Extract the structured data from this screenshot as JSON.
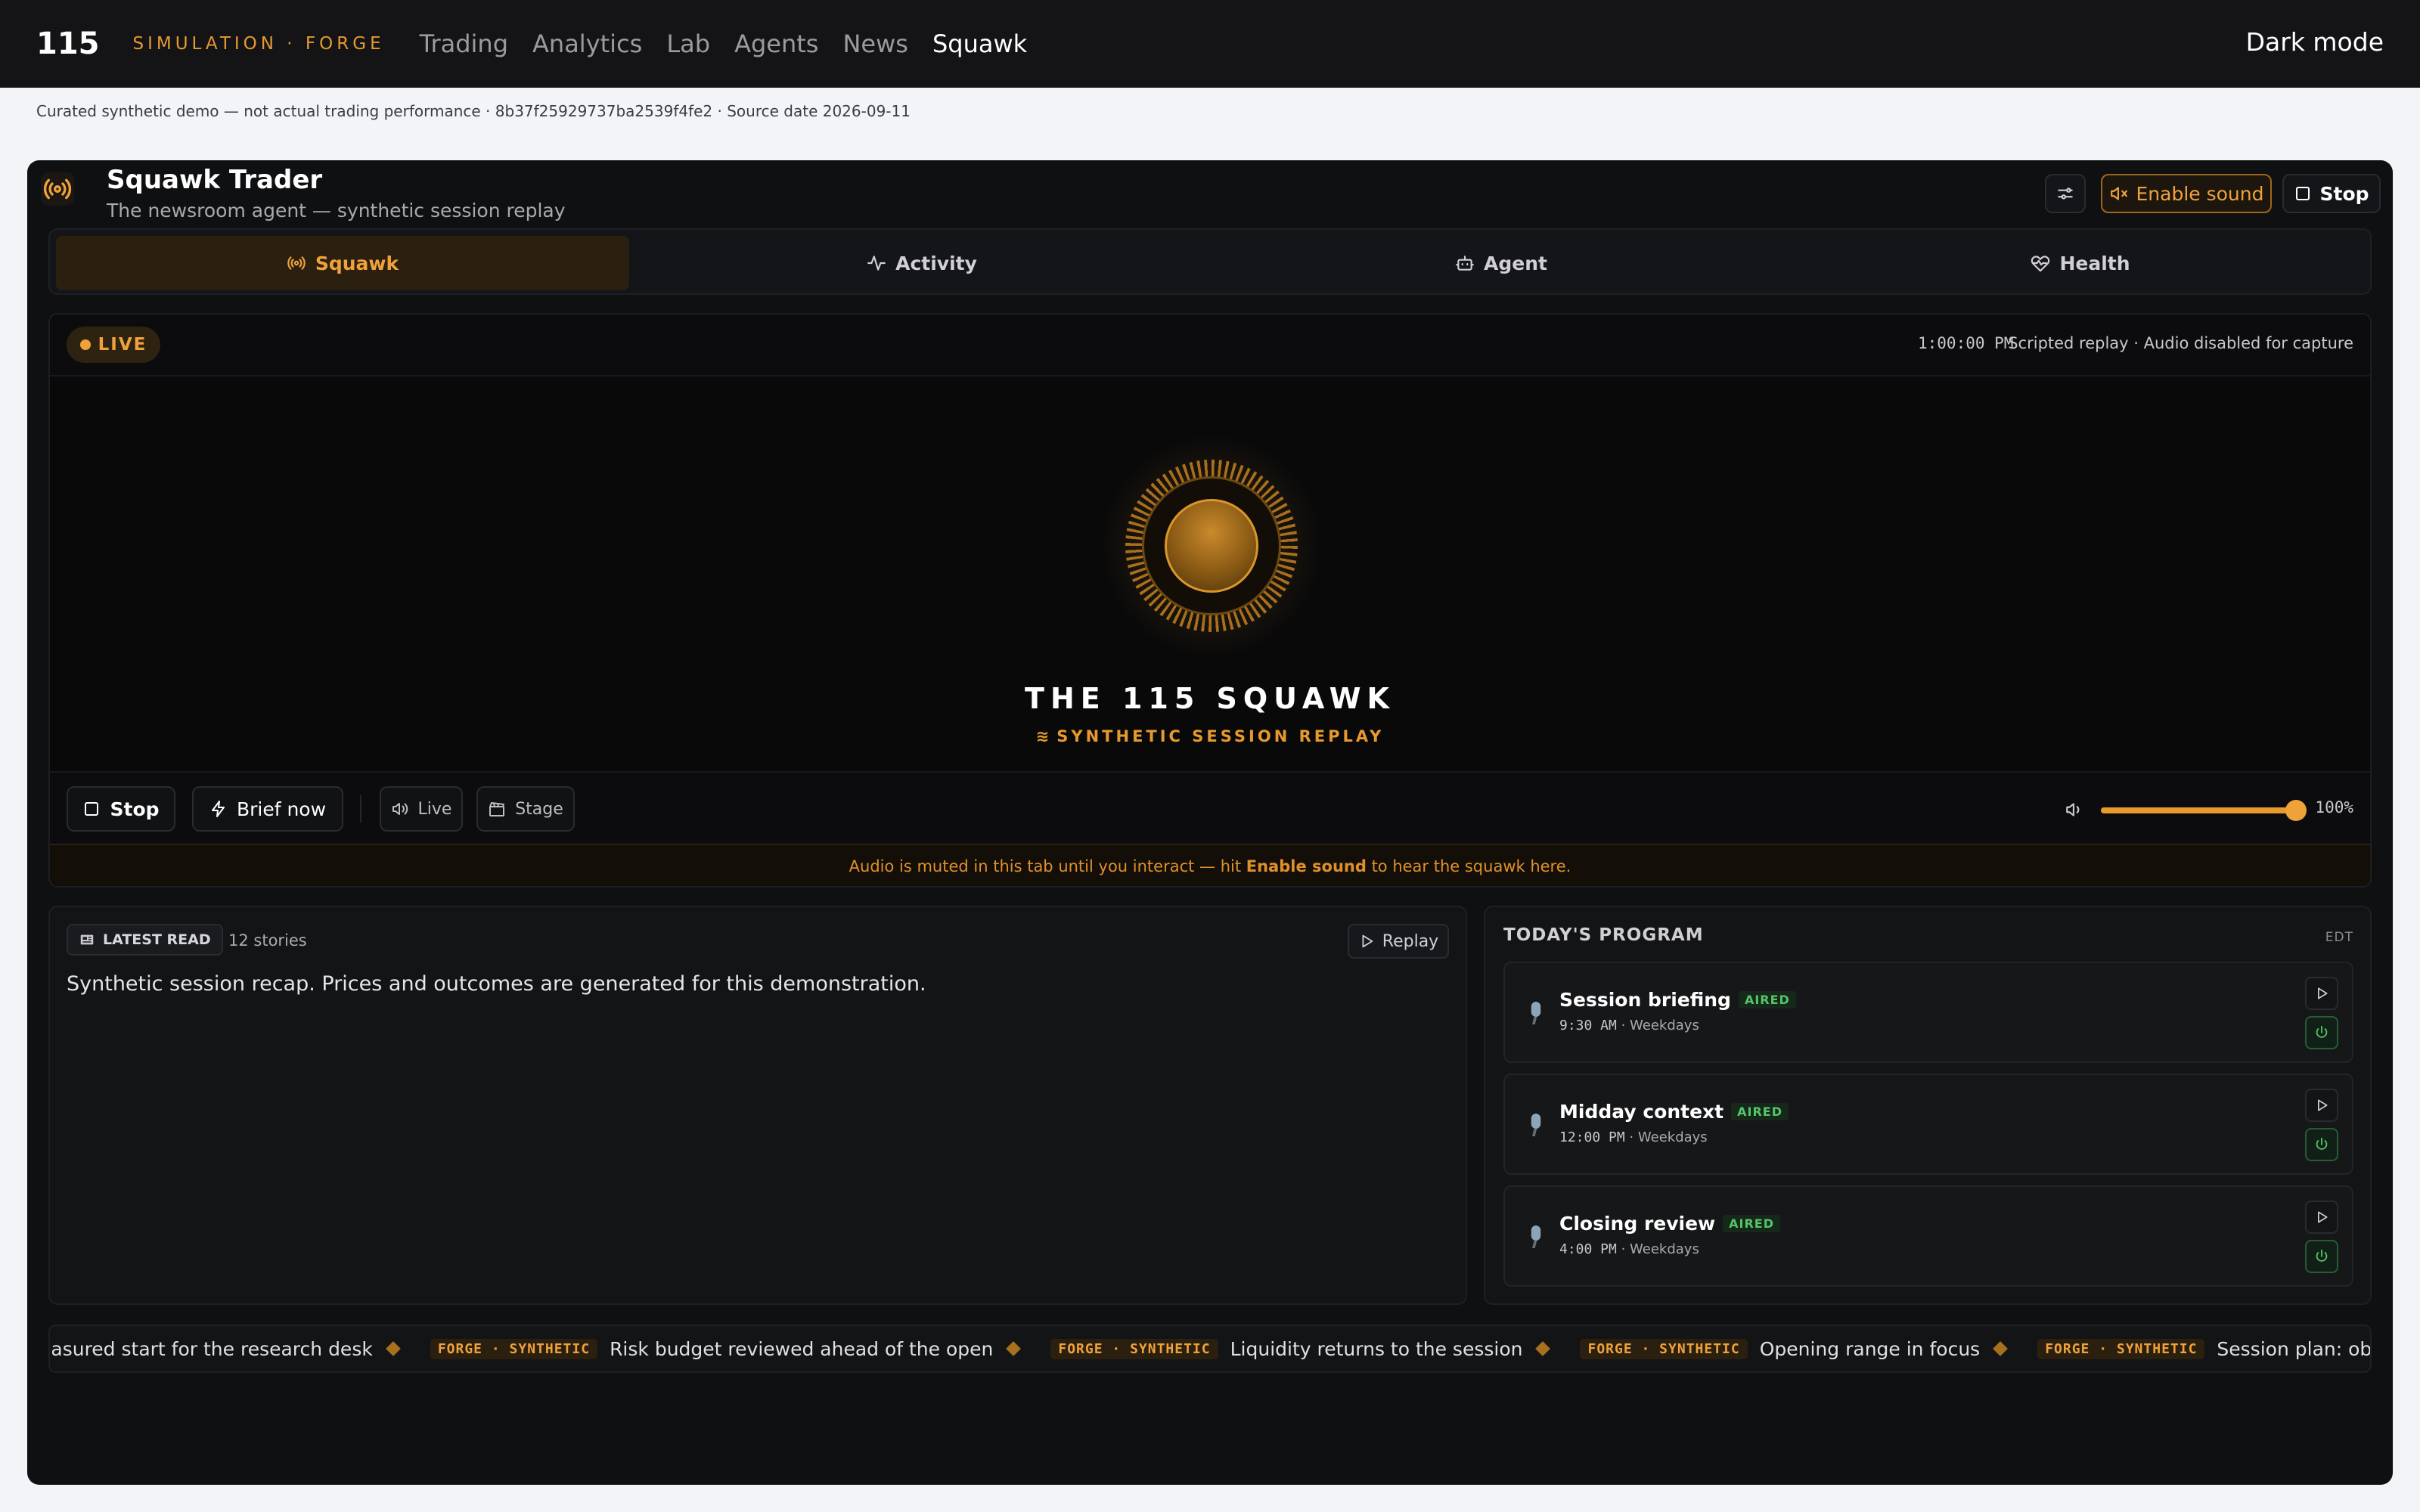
{
  "nav": {
    "logo": "115",
    "brand": "SIMULATION · FORGE",
    "links": [
      "Trading",
      "Analytics",
      "Lab",
      "Agents",
      "News",
      "Squawk"
    ],
    "active": "Squawk",
    "dark_mode": "Dark mode"
  },
  "disclaimer": "Curated synthetic demo — not actual trading performance · 8b37f25929737ba2539f4fe2 · Source date 2026-09-11",
  "header": {
    "title": "Squawk Trader",
    "subtitle": "The newsroom agent — synthetic session replay",
    "enable_sound": "Enable sound",
    "stop": "Stop"
  },
  "tabs": [
    {
      "label": "Squawk",
      "icon": "radio-icon"
    },
    {
      "label": "Activity",
      "icon": "pulse-icon"
    },
    {
      "label": "Agent",
      "icon": "bot-icon"
    },
    {
      "label": "Health",
      "icon": "heart-pulse-icon"
    }
  ],
  "player": {
    "live": "LIVE",
    "clock": "1:00:00 PM",
    "note": "Scripted replay · Audio disabled for capture",
    "show_title": "THE 115 SQUAWK",
    "show_sub": "SYNTHETIC SESSION REPLAY",
    "controls": {
      "stop": "Stop",
      "brief_now": "Brief now",
      "live": "Live",
      "stage": "Stage"
    },
    "volume": 1.0,
    "volume_label": "100%",
    "mute_prefix": "Audio is muted in this tab until you interact — hit ",
    "mute_bold": "Enable sound",
    "mute_suffix": " to hear the squawk here."
  },
  "latest_read": {
    "badge": "LATEST READ",
    "count": "12 stories",
    "replay": "Replay",
    "text": "Synthetic session recap. Prices and outcomes are generated for this demonstration."
  },
  "program": {
    "title": "TODAY'S PROGRAM",
    "tz": "EDT",
    "items": [
      {
        "name": "Session briefing",
        "status": "AIRED",
        "time": "9:30 AM",
        "days": "Weekdays"
      },
      {
        "name": "Midday context",
        "status": "AIRED",
        "time": "12:00 PM",
        "days": "Weekdays"
      },
      {
        "name": "Closing review",
        "status": "AIRED",
        "time": "4:00 PM",
        "days": "Weekdays"
      }
    ]
  },
  "ticker": {
    "lead": "easured start for the research desk",
    "items": [
      {
        "tag": "FORGE · SYNTHETIC",
        "text": "Risk budget reviewed ahead of the open"
      },
      {
        "tag": "FORGE · SYNTHETIC",
        "text": "Liquidity returns to the session"
      },
      {
        "tag": "FORGE · SYNTHETIC",
        "text": "Opening range in focus"
      },
      {
        "tag": "FORGE · SYNTHETIC",
        "text": "Session plan: observe, execute,"
      }
    ]
  },
  "colors": {
    "accent": "#f0a23a",
    "aired": "#56c46a",
    "surface": "#0f1012"
  }
}
